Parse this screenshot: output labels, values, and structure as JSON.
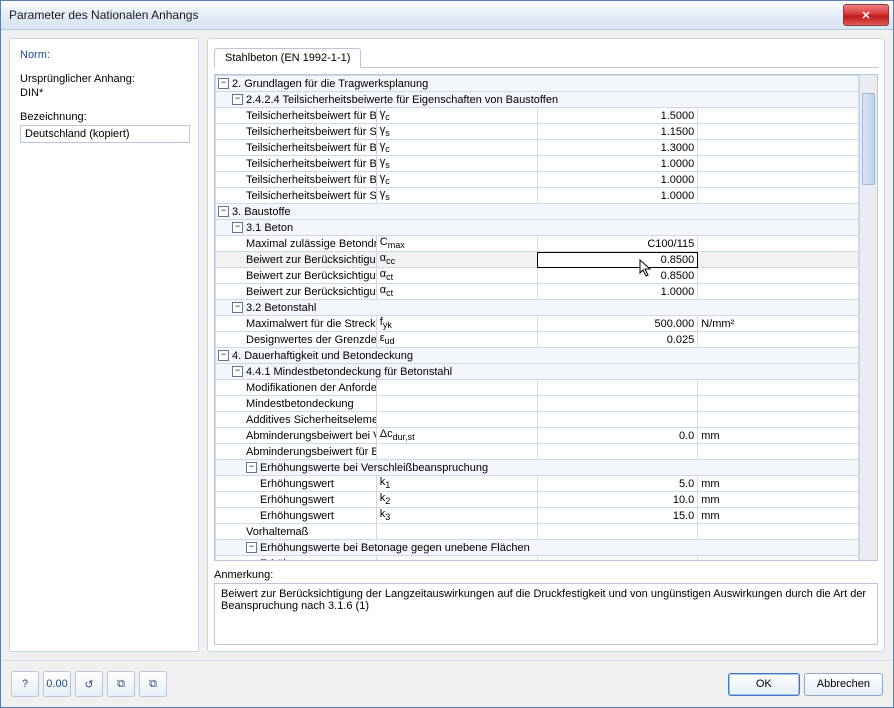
{
  "window": {
    "title": "Parameter des Nationalen Anhangs",
    "close_glyph": "✕"
  },
  "left": {
    "norm_label": "Norm:",
    "origin_label": "Ursprünglicher Anhang:",
    "origin_value": "DIN*",
    "designation_label": "Bezeichnung:",
    "designation_value": "Deutschland (kopiert)"
  },
  "tab": {
    "label": "Stahlbeton (EN 1992-1-1)"
  },
  "rows": [
    {
      "t": "h",
      "lvl": 0,
      "exp": "-",
      "label": "2. Grundlagen für die Tragwerksplanung"
    },
    {
      "t": "h",
      "lvl": 1,
      "exp": "-",
      "label": "2.4.2.4 Teilsicherheitsbeiwerte für Eigenschaften von Baustoffen"
    },
    {
      "t": "p",
      "lvl": 2,
      "label": "Teilsicherheitsbeiwert für Beton im Grenzzustand der Tragfähigkeit (ständige, vorübergehende)",
      "sym": "γ c",
      "val": "1.5000",
      "unit": ""
    },
    {
      "t": "p",
      "lvl": 2,
      "label": "Teilsicherheitsbeiwert für Stahl im Grenzzustand der Tragfähigkeit (ständige, vorübergehende)",
      "sym": "γ s",
      "val": "1.1500",
      "unit": ""
    },
    {
      "t": "p",
      "lvl": 2,
      "label": "Teilsicherheitsbeiwert für Beton im Grenzzustand der Tragfähigkeit (Außergewöhnlich)",
      "sym": "γ c",
      "val": "1.3000",
      "unit": ""
    },
    {
      "t": "p",
      "lvl": 2,
      "label": "Teilsicherheitsbeiwert für Betonstahl im Grenzzustand der Tragfähigkeit (Außergewöhnlich)",
      "sym": "γ s",
      "val": "1.0000",
      "unit": ""
    },
    {
      "t": "p",
      "lvl": 2,
      "label": "Teilsicherheitsbeiwert für Beton im Grenzzustand der Gebrauchstauglichkeit",
      "sym": "γ c",
      "val": "1.0000",
      "unit": ""
    },
    {
      "t": "p",
      "lvl": 2,
      "label": "Teilsicherheitsbeiwert für Stahl im Grenzzustand der Gebrauchstauglichkeit",
      "sym": "γ s",
      "val": "1.0000",
      "unit": ""
    },
    {
      "t": "h",
      "lvl": 0,
      "exp": "-",
      "label": "3. Baustoffe"
    },
    {
      "t": "h",
      "lvl": 1,
      "exp": "-",
      "label": "3.1 Beton"
    },
    {
      "t": "p",
      "lvl": 2,
      "label": "Maximal zulässige Betondruckfestigkeitsklasse",
      "sym": "C max",
      "val": "C100/115",
      "unit": ""
    },
    {
      "t": "p",
      "lvl": 2,
      "label": "Beiwert zur Berücksichtigung Langzeiteinwirkung auf Druckfestigkeit",
      "sym": "α cc",
      "val": "0.8500",
      "unit": "",
      "sel": true
    },
    {
      "t": "p",
      "lvl": 2,
      "label": "Beiwert zur Berücksichtigung Langzeiteinwirkung auf Zugfestigkeit",
      "sym": "α ct",
      "val": "0.8500",
      "unit": ""
    },
    {
      "t": "p",
      "lvl": 2,
      "label": "Beiwert zur Berücksichtigung Langzeiteinwirkung auf Verbundspannung",
      "sym": "α ct",
      "val": "1.0000",
      "unit": ""
    },
    {
      "t": "h",
      "lvl": 1,
      "exp": "-",
      "label": "3.2 Betonstahl"
    },
    {
      "t": "p",
      "lvl": 2,
      "label": "Maximalwert für die Streckgrenze",
      "sym": "f yk",
      "val": "500.000",
      "unit": "N/mm²"
    },
    {
      "t": "p",
      "lvl": 2,
      "label": "Designwertes der Grenzdehnung Betonstahl",
      "sym": "ε ud",
      "val": "0.025",
      "unit": ""
    },
    {
      "t": "h",
      "lvl": 0,
      "exp": "-",
      "label": "4. Dauerhaftigkeit und Betondeckung"
    },
    {
      "t": "h",
      "lvl": 1,
      "exp": "-",
      "label": "4.4.1 Mindestbetondeckung für Betonstahl"
    },
    {
      "t": "p",
      "lvl": 2,
      "label": "Modifikationen der Anforderungsklasse",
      "sym": "",
      "val": "",
      "unit": ""
    },
    {
      "t": "p",
      "lvl": 2,
      "label": "Mindestbetondeckung",
      "sym": "",
      "val": "",
      "unit": ""
    },
    {
      "t": "p",
      "lvl": 2,
      "label": "Additives Sicherheitselement zur Erhöhung der Mindestbetondeckung",
      "sym": "",
      "val": "",
      "unit": ""
    },
    {
      "t": "p",
      "lvl": 2,
      "label": "Abminderungsbeiwert bei Verwendung von rostfreiem Stahl",
      "sym": "Δc dur,st",
      "val": "0.0",
      "unit": "mm"
    },
    {
      "t": "p",
      "lvl": 2,
      "label": "Abminderungsbeiwert für Beton mit zusätzlichem Schutz",
      "sym": "",
      "val": "",
      "unit": ""
    },
    {
      "t": "h",
      "lvl": 2,
      "exp": "-",
      "label": "Erhöhungswerte bei Verschleißbeanspruchung"
    },
    {
      "t": "p",
      "lvl": 3,
      "label": "Erhöhungswert",
      "sym": "k 1",
      "val": "5.0",
      "unit": "mm"
    },
    {
      "t": "p",
      "lvl": 3,
      "label": "Erhöhungswert",
      "sym": "k 2",
      "val": "10.0",
      "unit": "mm"
    },
    {
      "t": "p",
      "lvl": 3,
      "label": "Erhöhungswert",
      "sym": "k 3",
      "val": "15.0",
      "unit": "mm"
    },
    {
      "t": "p",
      "lvl": 2,
      "label": "Vorhaltemaß",
      "sym": "",
      "val": "",
      "unit": ""
    },
    {
      "t": "h",
      "lvl": 2,
      "exp": "-",
      "label": "Erhöhungswerte bei Betonage gegen unebene Flächen"
    },
    {
      "t": "p",
      "lvl": 3,
      "label": "Erhöhungswert",
      "sym": "",
      "val": "",
      "unit": ""
    }
  ],
  "note": {
    "label": "Anmerkung:",
    "text": "Beiwert zur Berücksichtigung der Langzeitauswirkungen auf die Druckfestigkeit und von ungünstigen Auswirkungen durch die Art der Beanspruchung nach 3.1.6 (1)"
  },
  "footer": {
    "icons": [
      "?",
      "0.00",
      "↺",
      "⧉",
      "⧉"
    ],
    "ok": "OK",
    "cancel": "Abbrechen"
  }
}
